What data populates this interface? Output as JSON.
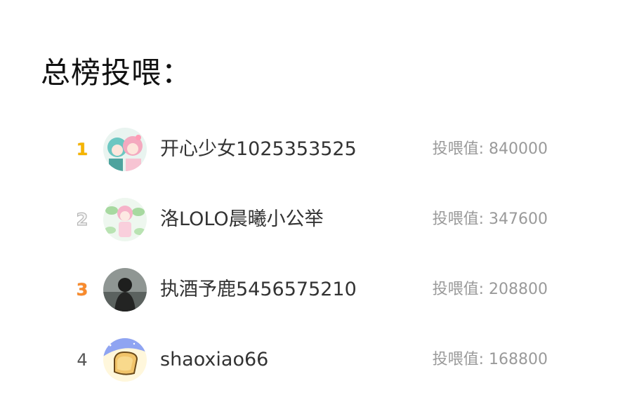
{
  "page": {
    "title": "总榜投喂："
  },
  "ranking": {
    "value_label": "投喂值: ",
    "entries": [
      {
        "rank": "1",
        "name": "开心少女1025353525",
        "value": "840000",
        "avatar_icon": "anime-twins-avatar-icon"
      },
      {
        "rank": "2",
        "name": "洛LOLO晨曦小公举",
        "value": "347600",
        "avatar_icon": "anime-girl-lotus-avatar-icon"
      },
      {
        "rank": "3",
        "name": "执酒予鹿5456575210",
        "value": "208800",
        "avatar_icon": "dark-silhouette-avatar-icon"
      },
      {
        "rank": "4",
        "name": "shaoxiao66",
        "value": "168800",
        "avatar_icon": "toast-bread-avatar-icon"
      }
    ]
  },
  "colors": {
    "gold": "#f5b400",
    "silver": "#c8c8c8",
    "bronze": "#f98a2b",
    "value_text": "#9a9a9a",
    "name_text": "#333333"
  }
}
